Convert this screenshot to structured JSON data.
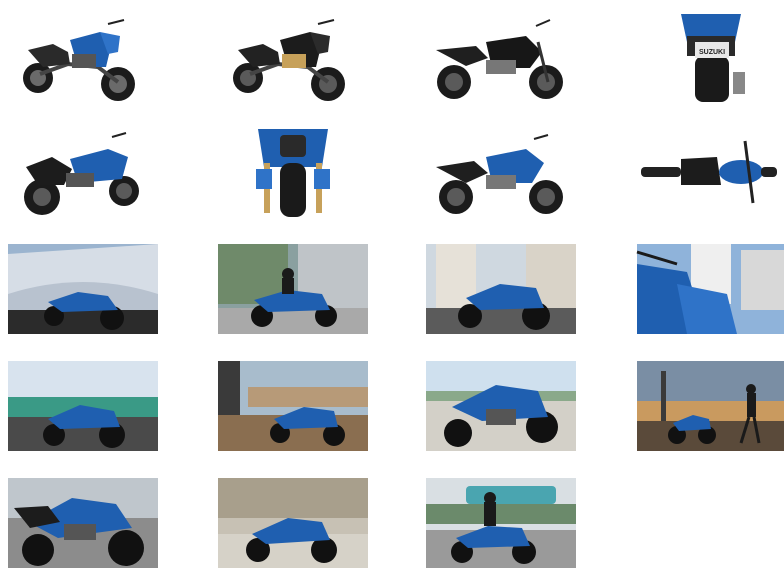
{
  "gallery": {
    "background": "#ffffff",
    "accent_color": "#1f5fb0",
    "items": [
      {
        "kind": "studio",
        "view": "front-right-three-quarter",
        "icon": "motorcycle-photo"
      },
      {
        "kind": "studio",
        "view": "front-right-three-quarter-dark",
        "icon": "motorcycle-photo"
      },
      {
        "kind": "studio",
        "view": "right-side",
        "icon": "motorcycle-photo"
      },
      {
        "kind": "studio",
        "view": "rear",
        "icon": "motorcycle-photo",
        "plate_text": "SUZUKI"
      },
      {
        "kind": "studio",
        "view": "rear-left-three-quarter",
        "icon": "motorcycle-photo"
      },
      {
        "kind": "studio",
        "view": "front",
        "icon": "motorcycle-photo"
      },
      {
        "kind": "studio",
        "view": "right-side-alt",
        "icon": "motorcycle-photo"
      },
      {
        "kind": "studio",
        "view": "top",
        "icon": "motorcycle-photo"
      },
      {
        "kind": "scene",
        "view": "modern-building",
        "icon": "motorcycle-photo"
      },
      {
        "kind": "scene",
        "view": "rider-city-street",
        "icon": "motorcycle-photo"
      },
      {
        "kind": "scene",
        "view": "parked-apartments",
        "icon": "motorcycle-photo"
      },
      {
        "kind": "scene",
        "view": "closeup-skyline",
        "icon": "motorcycle-photo"
      },
      {
        "kind": "scene",
        "view": "tram-street",
        "icon": "motorcycle-photo"
      },
      {
        "kind": "scene",
        "view": "plaza-sunset",
        "icon": "motorcycle-photo"
      },
      {
        "kind": "scene",
        "view": "riverside-lowangle",
        "icon": "motorcycle-photo"
      },
      {
        "kind": "scene",
        "view": "rider-obelisk-dusk",
        "icon": "motorcycle-photo"
      },
      {
        "kind": "scene",
        "view": "closeup-street",
        "icon": "motorcycle-photo"
      },
      {
        "kind": "scene",
        "view": "palace-square",
        "icon": "motorcycle-photo"
      },
      {
        "kind": "scene",
        "view": "rider-riding-bus",
        "icon": "motorcycle-photo"
      }
    ]
  }
}
